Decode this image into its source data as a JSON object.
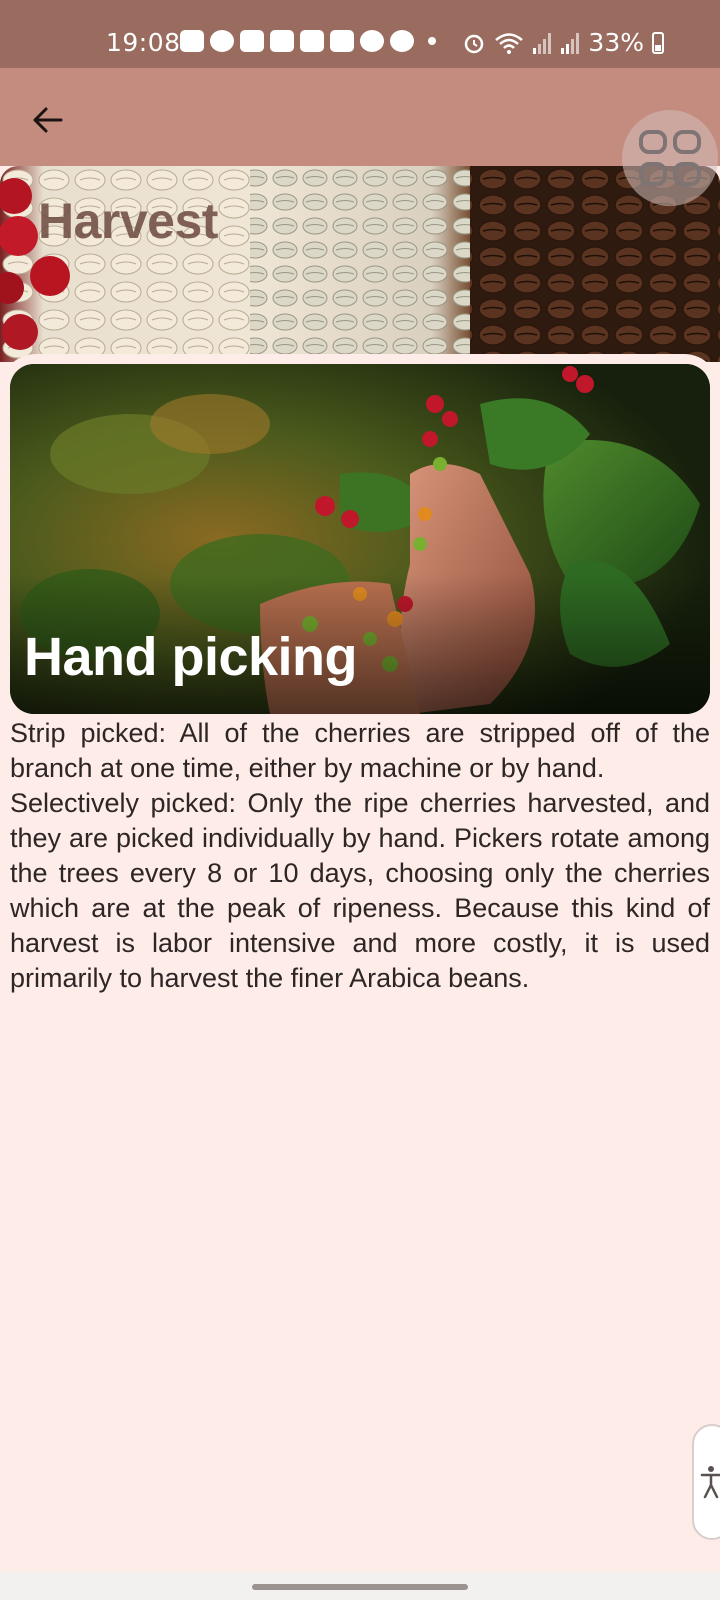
{
  "status_bar": {
    "time": "19:08",
    "battery": "33%",
    "notification_icons": [
      "message-icon",
      "telegram-icon",
      "v-app-icon",
      "youtube-icon",
      "youtube-icon",
      "hourglass-icon",
      "pinterest-icon",
      "pinterest-icon",
      "dot-icon"
    ],
    "system_icons": [
      "alarm-icon",
      "wifi-icon",
      "signal-icon",
      "signal-icon",
      "battery-icon"
    ]
  },
  "app_bar": {
    "back_icon": "arrow-left-icon"
  },
  "header": {
    "title": "Harvest",
    "grid_icon": "grid-icon"
  },
  "card": {
    "title": "Hand picking",
    "paragraphs": [
      "Strip picked: All of the cherries are stripped off of the branch at one time, either by machine or by hand.",
      "Selectively picked: Only the ripe cherries harvested, and they are picked individually by hand. Pickers rotate among the trees every 8 or 10 days, choosing only the cherries which are at the peak of ripeness. Because this kind of harvest is labor intensive and more costly, it is used primarily to harvest the finer Arabica beans."
    ]
  },
  "accessibility": {
    "icon": "accessibility-icon"
  },
  "colors": {
    "status_bar": "#9a6c60",
    "app_bar": "#c48c7e",
    "background": "#fdece7",
    "text": "#2e2624"
  }
}
